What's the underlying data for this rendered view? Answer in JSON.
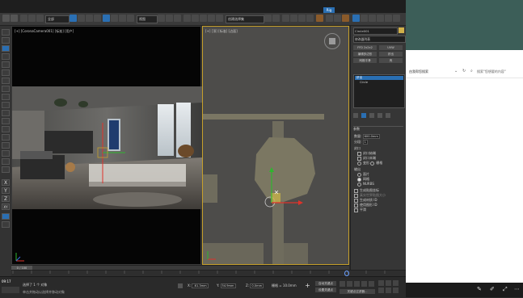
{
  "toolbar": {
    "layer_dropdown": "全部",
    "view_dropdown": "视图",
    "selection_set": "创建选择集",
    "extra_label": "Rig"
  },
  "viewports": {
    "left_label": "[+] [CoronaCamera001] [标准] [用户]",
    "right_label": "[+] [顶] [标准] [边面]"
  },
  "command_panel": {
    "object_name": "Circle001",
    "modifier_list": "修改器列表",
    "modifier_buttons": [
      "FFD 2x2x2",
      "UVW",
      "编辑多边形",
      "挤出",
      "网格平滑",
      "壳"
    ],
    "stack_items": [
      "挤出",
      "Circle"
    ],
    "rollout_params": "参数",
    "amount_label": "数量:",
    "amount_value": "600.0mm",
    "segments_label": "分段:",
    "segments_value": "1",
    "capping_title": "封口",
    "cap_start": "封口始端",
    "cap_end": "封口末端",
    "morph": "变形",
    "grid": "栅格",
    "output_title": "输出",
    "out_patch": "面片",
    "out_mesh": "网格",
    "out_nurbs": "NURBS",
    "gen_map": "生成贴图坐标",
    "real_world": "真实世界贴图大小",
    "gen_mat": "生成材质 ID",
    "smooth_groups": "使用图形 ID",
    "smooth": "平滑"
  },
  "right_app": {
    "address_text": "由我帮您搜索",
    "search_placeholder": "搜索\"您想要的内容\""
  },
  "timeline": {
    "frame_counter": "0 / 100",
    "ticks": [
      "0",
      "5",
      "10",
      "15",
      "20",
      "25",
      "30",
      "35",
      "40",
      "45",
      "50",
      "55",
      "60",
      "65",
      "70",
      "75",
      "80",
      "85",
      "90",
      "95",
      "100"
    ]
  },
  "status": {
    "time": "09:17",
    "selected_text": "选择了 1 个 对象",
    "hint_text": "单击并拖动以选择并移动对象",
    "x_label": "X:",
    "x_value": "-61.3mm",
    "y_label": "Y:",
    "y_value": "54.9mm",
    "z_label": "Z:",
    "z_value": "0.0mm",
    "grid_label": "栅格 = 10.0mm",
    "autokey": "自动关键点",
    "set_key": "设置关键点",
    "filter": "关键点过滤器..."
  },
  "side_letters": [
    "X",
    "Y",
    "Z",
    "XY"
  ],
  "colors": {
    "accent_blue": "#2a6fb3",
    "viewport_border": "#c6a02b",
    "gizmo_x": "#e0322a",
    "gizmo_y": "#2fb52f"
  }
}
